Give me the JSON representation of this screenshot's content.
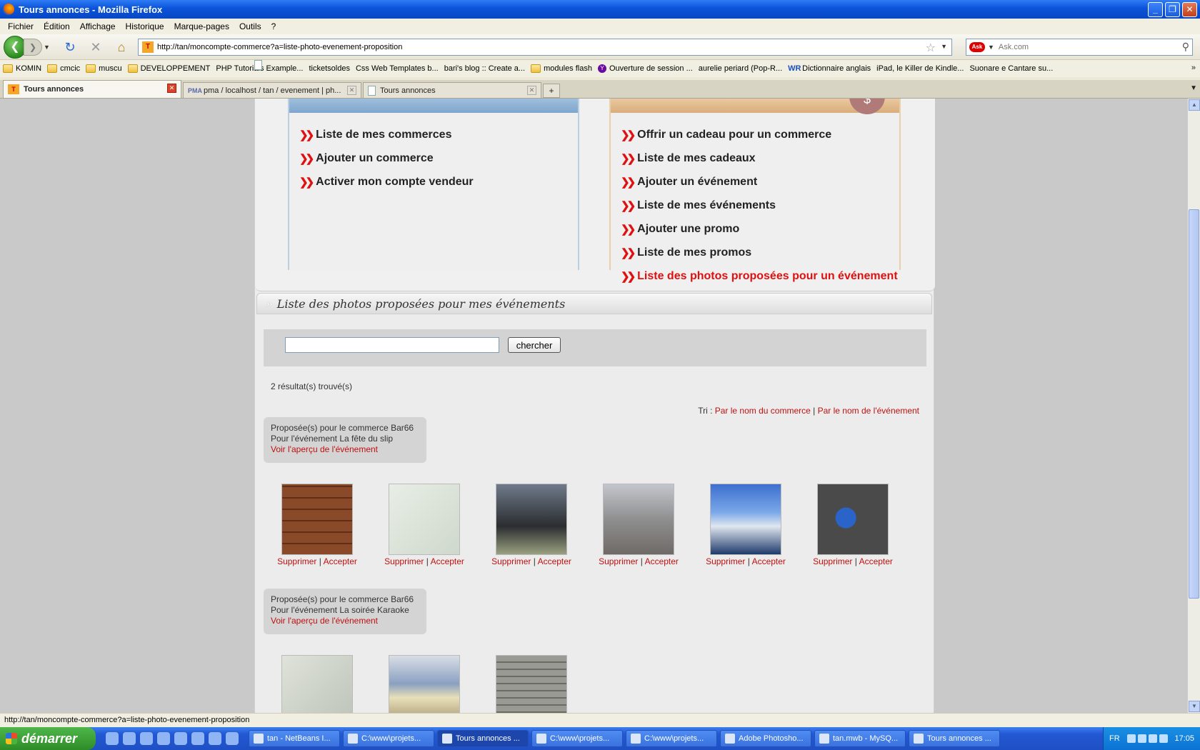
{
  "window": {
    "title": "Tours annonces - Mozilla Firefox",
    "min": "_",
    "max": "❐",
    "close": "✕"
  },
  "menu": [
    "Fichier",
    "Édition",
    "Affichage",
    "Historique",
    "Marque-pages",
    "Outils",
    "?"
  ],
  "nav": {
    "url": "http://tan/moncompte-commerce?a=liste-photo-evenement-proposition",
    "search_placeholder": "Ask.com"
  },
  "bookmarks": [
    {
      "label": "KOMIN",
      "type": "folder"
    },
    {
      "label": "cmcic",
      "type": "folder"
    },
    {
      "label": "muscu",
      "type": "folder"
    },
    {
      "label": "DEVELOPPEMENT",
      "type": "folder"
    },
    {
      "label": "PHP Tutorials Example...",
      "type": "page"
    },
    {
      "label": "ticketsoldes",
      "type": "page"
    },
    {
      "label": "Css Web Templates b...",
      "type": "page"
    },
    {
      "label": "bari's blog :: Create a...",
      "type": "page"
    },
    {
      "label": "modules flash",
      "type": "folder"
    },
    {
      "label": "Ouverture de session ...",
      "type": "yahoo"
    },
    {
      "label": "aurelie periard (Pop-R...",
      "type": "page"
    },
    {
      "label": "Dictionnaire anglais",
      "type": "wr"
    },
    {
      "label": "iPad, le Killer de Kindle...",
      "type": "page"
    },
    {
      "label": "Suonare e Cantare su...",
      "type": "page"
    }
  ],
  "tabs": [
    {
      "label": "Tours annonces",
      "active": true
    },
    {
      "label": "pma / localhost / tan / evenement | ph...",
      "active": false
    },
    {
      "label": "Tours annonces",
      "active": false
    }
  ],
  "panels": {
    "left_items": [
      "Liste de mes commerces",
      "Ajouter un commerce",
      "Activer mon compte vendeur"
    ],
    "right_items": [
      "Offrir un cadeau pour un commerce",
      "Liste de mes cadeaux",
      "Ajouter un événement",
      "Liste de mes événements",
      "Ajouter une promo",
      "Liste de mes promos",
      "Liste des photos proposées pour un événement"
    ],
    "dollar": "$"
  },
  "section": {
    "title": "Liste des photos proposées pour mes événements"
  },
  "search": {
    "button": "chercher",
    "value": ""
  },
  "results": {
    "count": "2 résultat(s) trouvé(s)",
    "sort_prefix": "Tri :",
    "sort_by_shop": "Par le nom du commerce",
    "sort_sep": "|",
    "sort_by_event": "Par le nom de l'événement"
  },
  "groups": [
    {
      "shop_line": "Proposée(s) pour le commerce Bar66",
      "event_line": "Pour l'événement La fête du slip",
      "link": "Voir l'aperçu de l'événement",
      "photos": [
        "wood",
        "sketch",
        "dark",
        "cathedral",
        "sign",
        "shell"
      ]
    },
    {
      "shop_line": "Proposée(s) pour le commerce Bar66",
      "event_line": "Pour l'événement La soirée Karaoke",
      "link": "Voir l'aperçu de l'événement",
      "photos": [
        "sketch2",
        "traffic",
        "stairs"
      ]
    }
  ],
  "photo_actions": {
    "delete": "Supprimer",
    "sep": "|",
    "accept": "Accepter"
  },
  "status": "http://tan/moncompte-commerce?a=liste-photo-evenement-proposition",
  "taskbar": {
    "start": "démarrer",
    "tasks": [
      "tan - NetBeans I...",
      "C:\\www\\projets...",
      "Tours annonces ...",
      "C:\\www\\projets...",
      "C:\\www\\projets...",
      "Adobe Photosho...",
      "tan.mwb - MySQ...",
      "Tours annonces ..."
    ],
    "lang": "FR",
    "clock": "17:05"
  }
}
